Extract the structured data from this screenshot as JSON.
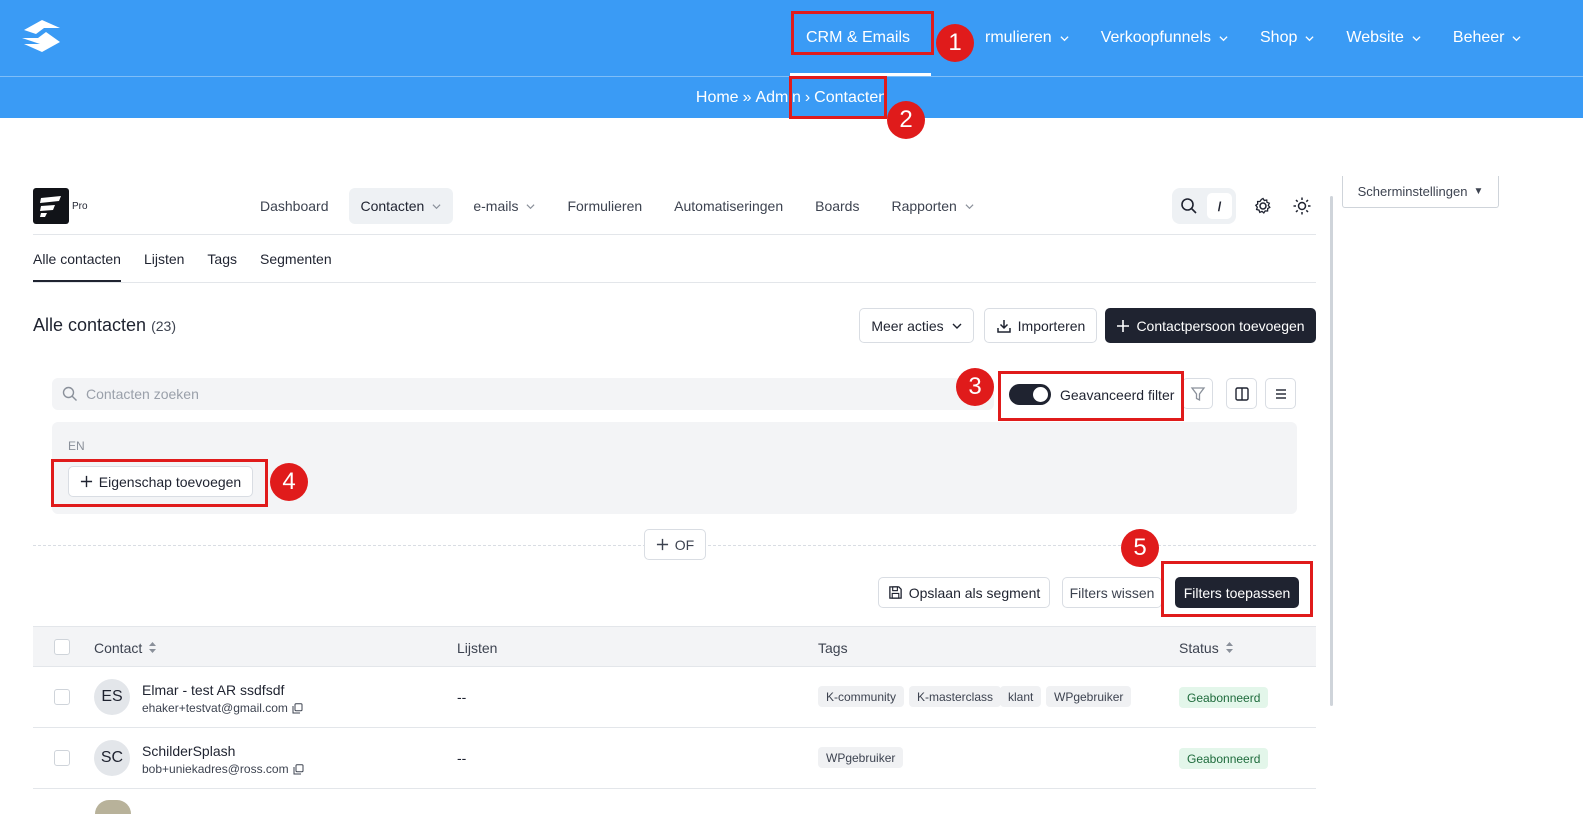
{
  "top_nav": {
    "items": [
      {
        "label": "CRM & Emails"
      },
      {
        "label": "Formulieren"
      },
      {
        "label": "Verkoopfunnels"
      },
      {
        "label": "Shop"
      },
      {
        "label": "Website"
      },
      {
        "label": "Beheer"
      }
    ],
    "top_nav_item_1_visible": "rmulieren"
  },
  "breadcrumb": {
    "home": "Home",
    "sep1": "»",
    "admin": "Admin",
    "sep2": "›",
    "current": "Contacten"
  },
  "screen_settings": "Scherminstellingen",
  "app": {
    "pro_label": "Pro",
    "nav": [
      {
        "label": "Dashboard"
      },
      {
        "label": "Contacten"
      },
      {
        "label": "e-mails"
      },
      {
        "label": "Formulieren"
      },
      {
        "label": "Automatiseringen"
      },
      {
        "label": "Boards"
      },
      {
        "label": "Rapporten"
      }
    ],
    "slash_key": "/"
  },
  "subtabs": [
    {
      "label": "Alle contacten"
    },
    {
      "label": "Lijsten"
    },
    {
      "label": "Tags"
    },
    {
      "label": "Segmenten"
    }
  ],
  "page": {
    "title": "Alle contacten",
    "count": "(23)",
    "more_actions": "Meer acties",
    "import": "Importeren",
    "add_contact": "Contactpersoon toevoegen"
  },
  "filter": {
    "search_placeholder": "Contacten zoeken",
    "advanced_filter": "Geavanceerd filter",
    "and_label": "EN",
    "add_property": "Eigenschap toevoegen",
    "or_label": "OF",
    "save_segment": "Opslaan als segment",
    "clear_filters": "Filters wissen",
    "apply_filters": "Filters toepassen",
    "advanced_filter_on": true
  },
  "table": {
    "headers": {
      "contact": "Contact",
      "lists": "Lijsten",
      "tags": "Tags",
      "status": "Status"
    },
    "rows": [
      {
        "initials": "ES",
        "name": "Elmar - test AR ssdfsdf",
        "email": "ehaker+testvat@gmail.com",
        "lists": "--",
        "tags": [
          "K-community",
          "K-masterclass",
          "klant",
          "WPgebruiker"
        ],
        "status": "Geabonneerd"
      },
      {
        "initials": "SC",
        "name": "SchilderSplash",
        "email": "bob+uniekadres@ross.com",
        "lists": "--",
        "tags": [
          "WPgebruiker"
        ],
        "status": "Geabonneerd"
      }
    ]
  },
  "annotations": [
    "1",
    "2",
    "3",
    "4",
    "5"
  ],
  "colors": {
    "brand_blue": "#3a9bf5",
    "annotation_red": "#e01b1b",
    "dark_button": "#1f2330",
    "status_green_bg": "#e3f6ea"
  }
}
